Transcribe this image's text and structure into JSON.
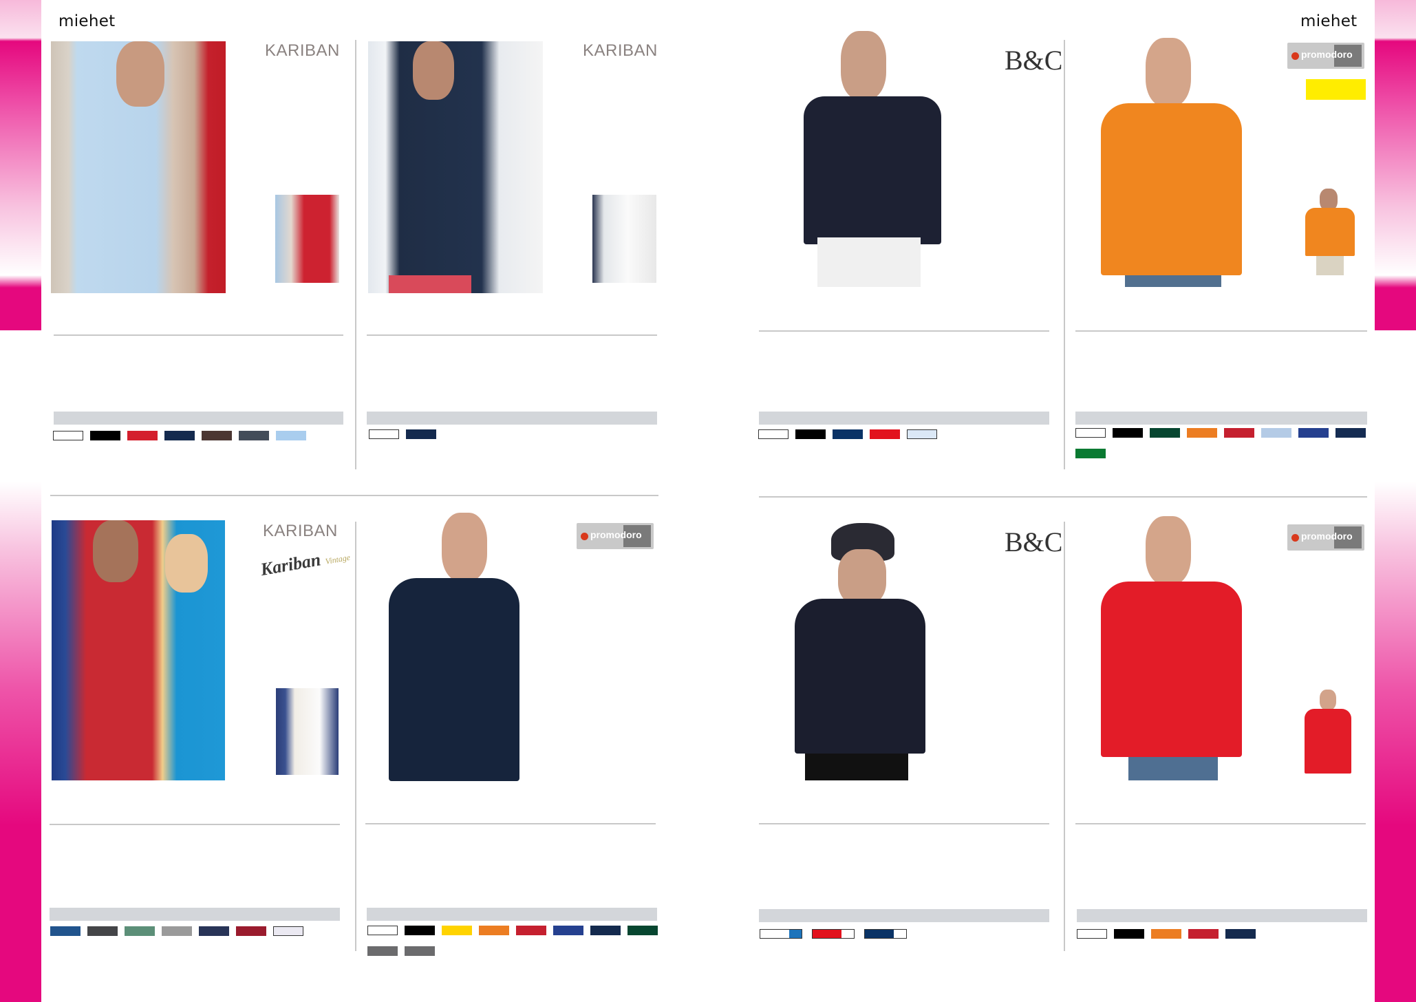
{
  "spread": {
    "left_title": "miehet",
    "right_title": "miehet",
    "tab_color": "#e5087e"
  },
  "brands": {
    "kariban": "KARIBAN",
    "bc": "B&C",
    "promodoro": "promodoro",
    "kariban_vintage": "Kariban",
    "vintage": "Vintage"
  },
  "products": [
    {
      "id": "p1",
      "brand": "KARIBAN",
      "swatches": [
        "#ffffff",
        "#000000",
        "#d41f2d",
        "#142a4e",
        "#4b3632",
        "#434c59",
        "#a9cdee"
      ]
    },
    {
      "id": "p2",
      "brand": "KARIBAN",
      "swatches": [
        "#ffffff",
        "#142a4e"
      ]
    },
    {
      "id": "p3",
      "brand": "B&C",
      "swatches": [
        "#ffffff",
        "#000000",
        "#0a3366",
        "#e2121d",
        "#dbe8f6"
      ]
    },
    {
      "id": "p4",
      "brand": "promodoro",
      "swatches": [
        "#ffffff",
        "#000000",
        "#074630",
        "#ec7d22",
        "#c5202f",
        "#b4cbe6",
        "#25408f",
        "#152c52",
        "#0a7a32"
      ]
    },
    {
      "id": "p5",
      "brand": "KARIBAN",
      "swatches": [
        "#21548d",
        "#444548",
        "#5c8f78",
        "#9a9a9a",
        "#283457",
        "#9a1b2d",
        "#ebe9f2"
      ]
    },
    {
      "id": "p6",
      "brand": "promodoro",
      "swatches": [
        "#ffffff",
        "#000000",
        "#ffd300",
        "#ec7d22",
        "#c5202f",
        "#25408f",
        "#142a4e",
        "#074630",
        "#6b6b6d",
        "#6b6b6d"
      ]
    },
    {
      "id": "p7",
      "brand": "B&C",
      "swatches": [
        [
          "#ffffff",
          "#1d74bb"
        ],
        [
          "#e2121d",
          "#ffffff"
        ],
        [
          "#0a3366",
          "#ffffff"
        ]
      ]
    },
    {
      "id": "p8",
      "brand": "promodoro",
      "swatches": [
        "#ffffff",
        "#000000",
        "#ec7d22",
        "#c5202f",
        "#142a4e"
      ]
    }
  ]
}
